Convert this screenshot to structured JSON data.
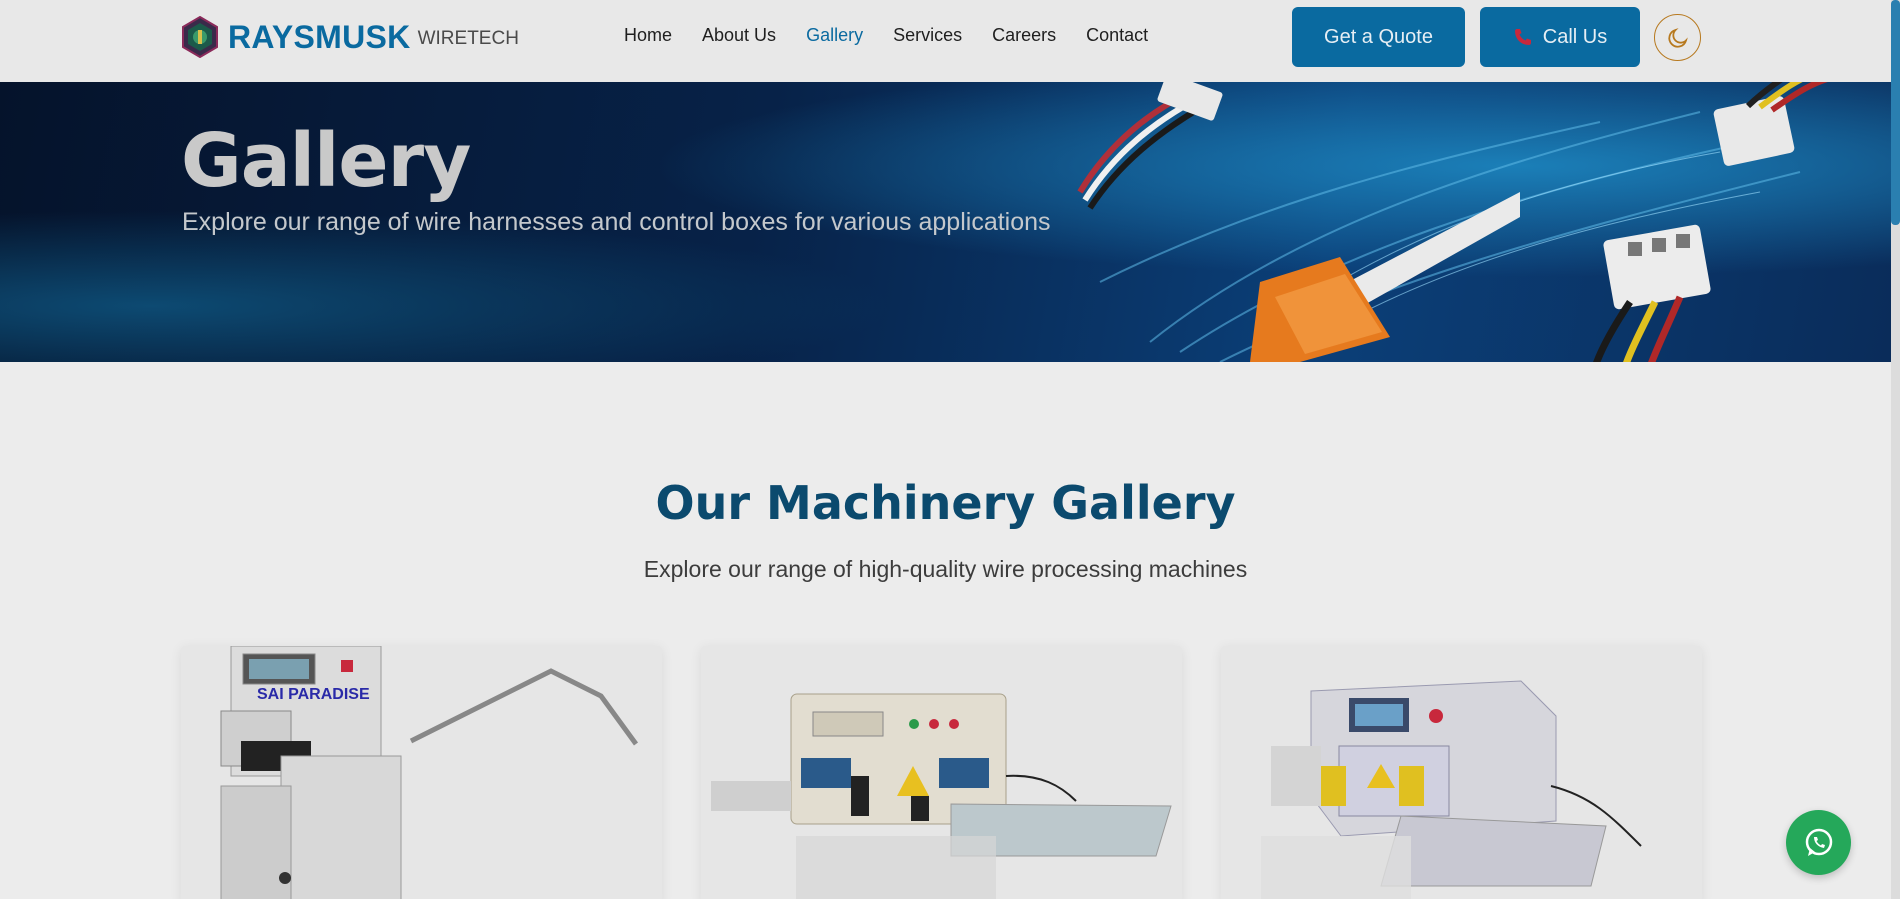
{
  "brand": {
    "name": "RAYSMUSK",
    "sub": "WIRETECH"
  },
  "nav": [
    {
      "label": "Home",
      "active": false
    },
    {
      "label": "About Us",
      "active": false
    },
    {
      "label": "Gallery",
      "active": true
    },
    {
      "label": "Services",
      "active": false
    },
    {
      "label": "Careers",
      "active": false
    },
    {
      "label": "Contact",
      "active": false
    }
  ],
  "actions": {
    "quote": "Get a Quote",
    "call": "Call Us"
  },
  "hero": {
    "title": "Gallery",
    "subtitle": "Explore our range of wire harnesses and control boxes for various applications"
  },
  "section": {
    "title": "Our Machinery Gallery",
    "subtitle": "Explore our range of high-quality wire processing machines"
  },
  "cards": [
    {
      "machine_label": "SAI PARADISE"
    },
    {
      "machine_label": ""
    },
    {
      "machine_label": ""
    }
  ],
  "colors": {
    "brand": "#0a6aa0",
    "heading": "#0b4a6e",
    "whatsapp": "#25a85a",
    "toggle": "#b7791f"
  },
  "icons": {
    "theme": "moon-icon",
    "call": "phone-icon",
    "chat": "whatsapp-icon",
    "logo": "hexagon-logo-icon"
  }
}
